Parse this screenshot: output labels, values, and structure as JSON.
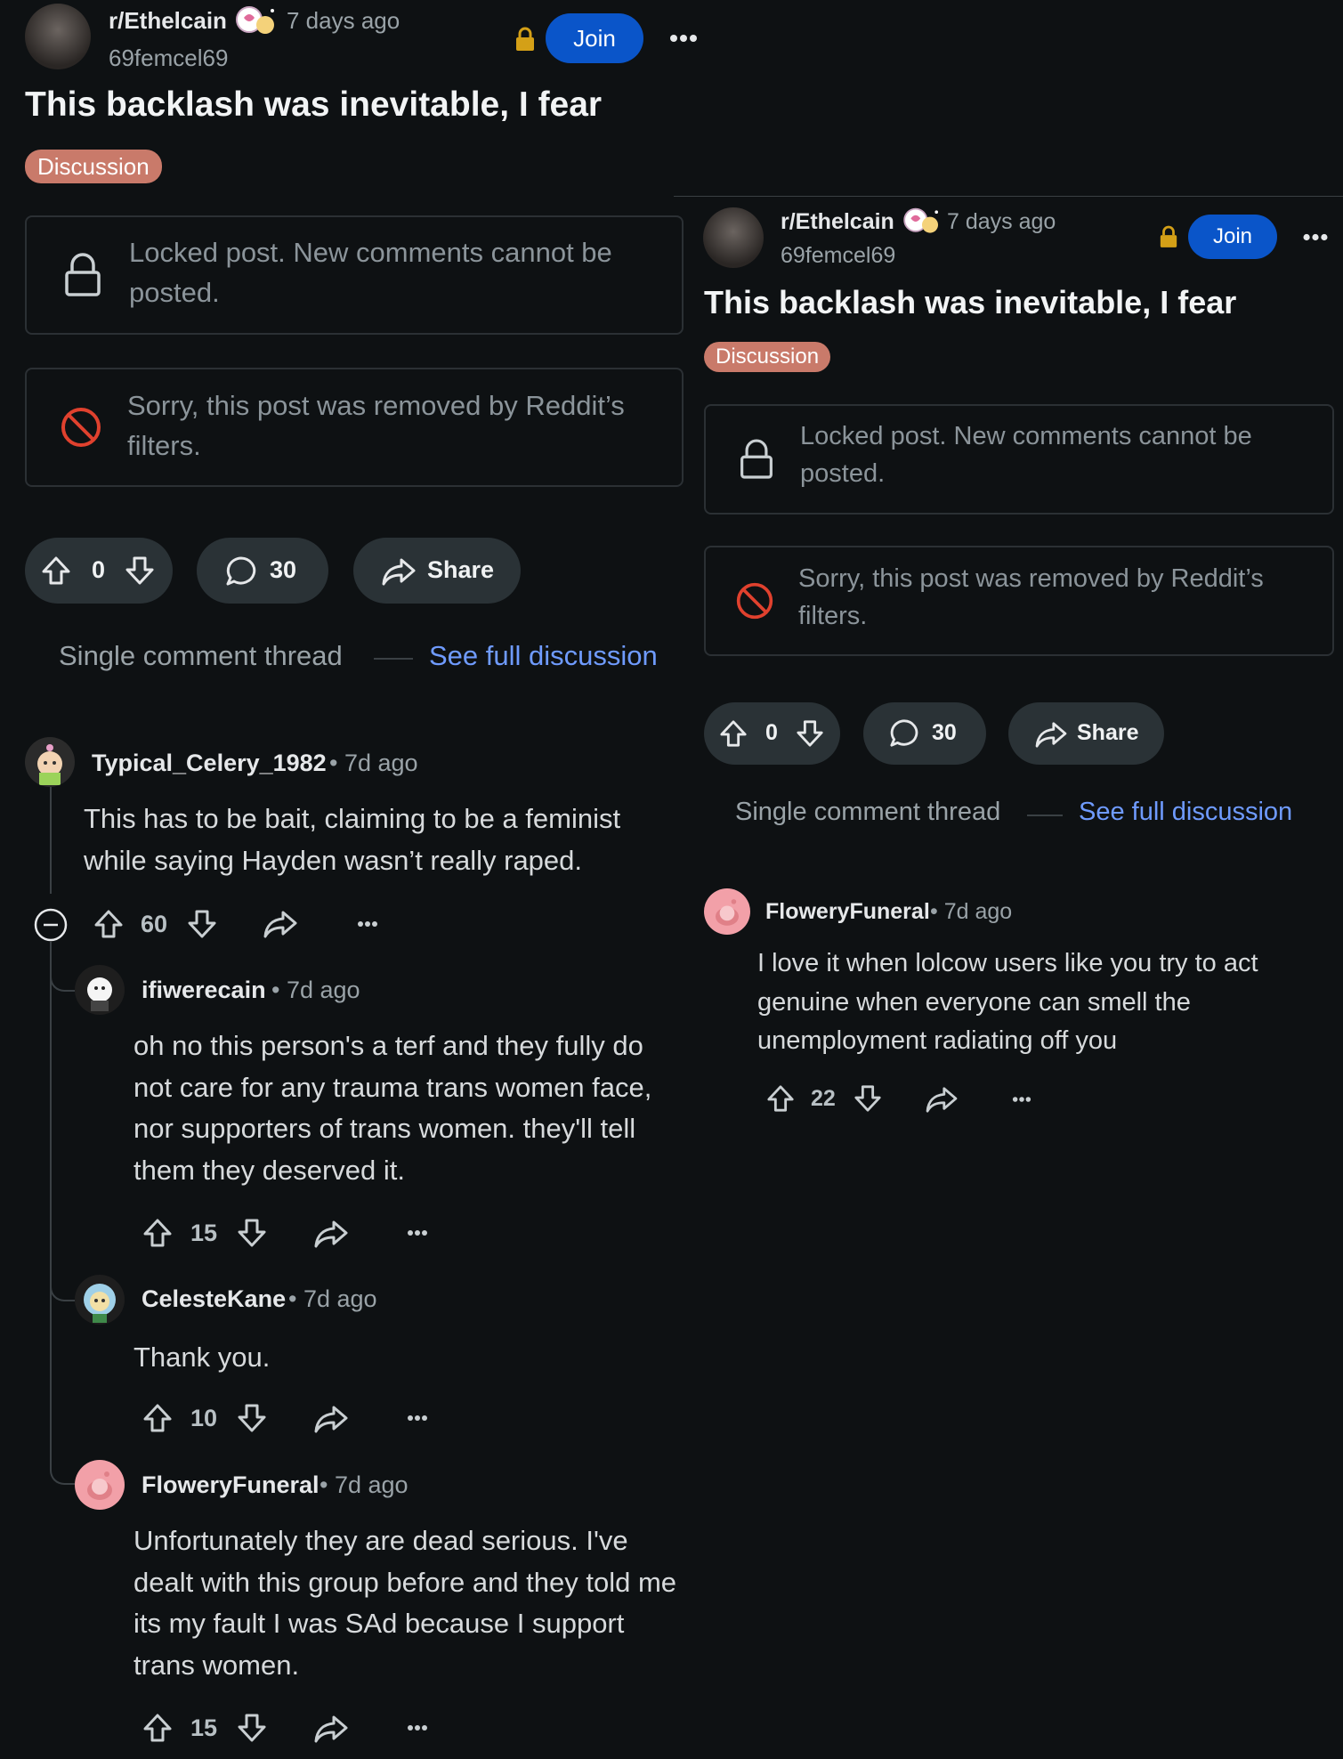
{
  "left": {
    "post": {
      "subreddit": "r/Ethelcain",
      "time": "7 days ago",
      "username": "69femcel69",
      "join_label": "Join",
      "title": "This backlash was inevitable, I fear",
      "flair": "Discussion",
      "locked_text": "Locked post. New comments cannot be posted.",
      "removed_text": "Sorry, this post was removed by Reddit’s filters.",
      "votes": "0",
      "comments": "30",
      "share_label": "Share",
      "thread_label": "Single comment thread",
      "see_full": "See full discussion"
    },
    "comments": [
      {
        "author": "Typical_Celery_1982",
        "time": "7d ago",
        "text": "This has to be bait, claiming to be a feminist while saying Hayden wasn’t really raped.",
        "votes": "60"
      },
      {
        "author": "ifiwerecain",
        "time": "7d ago",
        "text": "oh no this person's a terf and they fully do not care for any trauma trans women face, nor supporters of trans women. they'll tell them they deserved it.",
        "votes": "15"
      },
      {
        "author": "CelesteKane",
        "time": "7d ago",
        "text": "Thank you.",
        "votes": "10"
      },
      {
        "author": "FloweryFuneral",
        "time": "7d ago",
        "text": "Unfortunately they are dead serious. I've dealt with this group before and they told me its my fault I was SAd because I support trans women.",
        "votes": "15"
      }
    ]
  },
  "right": {
    "post": {
      "subreddit": "r/Ethelcain",
      "time": "7 days ago",
      "username": "69femcel69",
      "join_label": "Join",
      "title": "This backlash was inevitable, I fear",
      "flair": "Discussion",
      "locked_text": "Locked post. New comments cannot be posted.",
      "removed_text": "Sorry, this post was removed by Reddit’s filters.",
      "votes": "0",
      "comments": "30",
      "share_label": "Share",
      "thread_label": "Single comment thread",
      "see_full": "See full discussion"
    },
    "comments": [
      {
        "author": "FloweryFuneral",
        "time": "7d ago",
        "text": "I love it when lolcow users like you try to act genuine when everyone can smell the unemployment radiating off you",
        "votes": "22"
      }
    ]
  },
  "separator": "•",
  "colors": {
    "background": "#0e1113",
    "join": "#0a55c9",
    "flair": "#c97a6a",
    "link": "#6f9bff",
    "lock": "#d4a017",
    "removed": "#e0412e"
  }
}
